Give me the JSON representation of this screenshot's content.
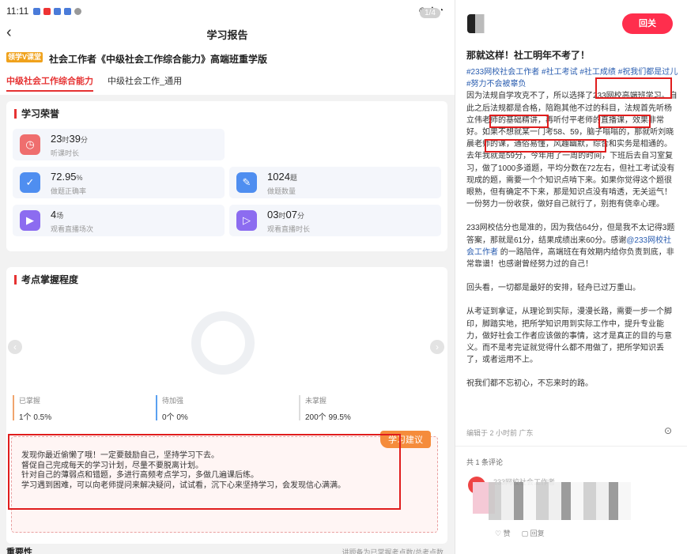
{
  "status": {
    "time": "11:11",
    "pager": "1/4"
  },
  "nav": {
    "title": "学习报告"
  },
  "course": {
    "logo": "领学V课堂",
    "title": "社会工作者《中级社会工作综合能力》高端班重学版",
    "tabs": [
      "中级社会工作综合能力",
      "中级社会工作_通用"
    ]
  },
  "honor": {
    "title": "学习荣誉",
    "stats": [
      {
        "value": "23",
        "unit": "时",
        "value2": "39",
        "unit2": "分",
        "label": "听课时长",
        "icon": "clock-icon",
        "color": "#ef6e6e"
      },
      {
        "value": "72.95",
        "unit": "%",
        "label": "做题正确率",
        "icon": "check-icon",
        "color": "#4f8ef0"
      },
      {
        "value": "1024",
        "unit": "题",
        "label": "做题数量",
        "icon": "pen-icon",
        "color": "#4f8ef0"
      },
      {
        "value": "4",
        "unit": "场",
        "label": "观看直播场次",
        "icon": "video-icon",
        "color": "#8c6cf0"
      },
      {
        "value": "03",
        "unit": "时",
        "value2": "07",
        "unit2": "分",
        "label": "观看直播时长",
        "icon": "play-icon",
        "color": "#8c6cf0"
      }
    ]
  },
  "mastery": {
    "title": "考点掌握程度",
    "legend": [
      {
        "label": "已掌握",
        "count": "1个",
        "pct": "0.5%",
        "color": "#f0a56e"
      },
      {
        "label": "待加强",
        "count": "0个",
        "pct": "0%",
        "color": "#5aa0f0"
      },
      {
        "label": "未掌握",
        "count": "200个",
        "pct": "99.5%",
        "color": "#dddddd"
      }
    ],
    "advice_tag": "学习建议",
    "advice_lines": [
      "发现你最近偷懒了哦！一定要鼓励自己，坚持学习下去。",
      "督促自己完成每天的学习计划，尽量不要脱离计划。",
      "针对自己的薄弱点和错题，多进行高频考点学习，多做几遍课后练。",
      "学习遇到困难，可以向老师提问来解决疑问，试试看，沉下心来坚持学习，会发现信心满满。"
    ]
  },
  "footer": {
    "title": "重要性",
    "note": "讲题备为已掌握考点数/总考点数"
  },
  "post": {
    "follow": "回关",
    "title": "那就这样！社工明年不考了！",
    "tags": "#233网校社会工作者 #社工考试 #社工成绩 #祝我们都是过儿 #努力不会被辜负",
    "para1": "因为法规自学攻克不了，所以选择了233网校高端班学习。自此之后法规都是合格，陪跑其他不过的科目，法规首先听杨立伟老师的基础精讲，再听付平老师的直播课，效果非常好。如果不想就某一门考58、59，脑子嗡嗡的，那就听刘晓晨老师的课，通俗易懂，风趣幽默，综合和实务是相通的。去年我就是59分，今年用了一周的时间，下班后去自习室复习，做了1000多道题，平均分数在72左右，但社工考试没有现成的题，需要一个个知识点啃下来。如果你觉得这个题很眼熟，但有确定不下来，那是知识点没有啃透，无关运气！一份努力一份收获，做好自己就行了，别抱有侥幸心理。",
    "para2a": "233网校估分也是准的，因为我估64分，但是我不太记得3题答案，那就是61分，结果成绩出来60分。感谢",
    "para2_mention": "@233网校社会工作者",
    "para2b": " 的一路陪伴，高端班在有效期内给你负责到底，非常靠谱！也感谢曾经努力过的自己！",
    "para3": "回头看，一切都是最好的安排，轻舟已过万重山。",
    "para4": "从考证到拿证，从理论到实际，漫漫长路，需要一步一个脚印，脚踏实地，把所学知识用到实际工作中，提升专业能力，做好社会工作者应该做的事情，这才是真正的目的与意义。而不是考完证就觉得什么都不用做了，把所学知识丢了，或者运用不上。",
    "para5": "祝我们都不忘初心，不忘来时的路。",
    "meta": "编辑于 2 小时前 广东",
    "comment_count": "共 1 条评论",
    "commenter": "233网校社会工作者",
    "like": "赞",
    "reply": "回复"
  }
}
